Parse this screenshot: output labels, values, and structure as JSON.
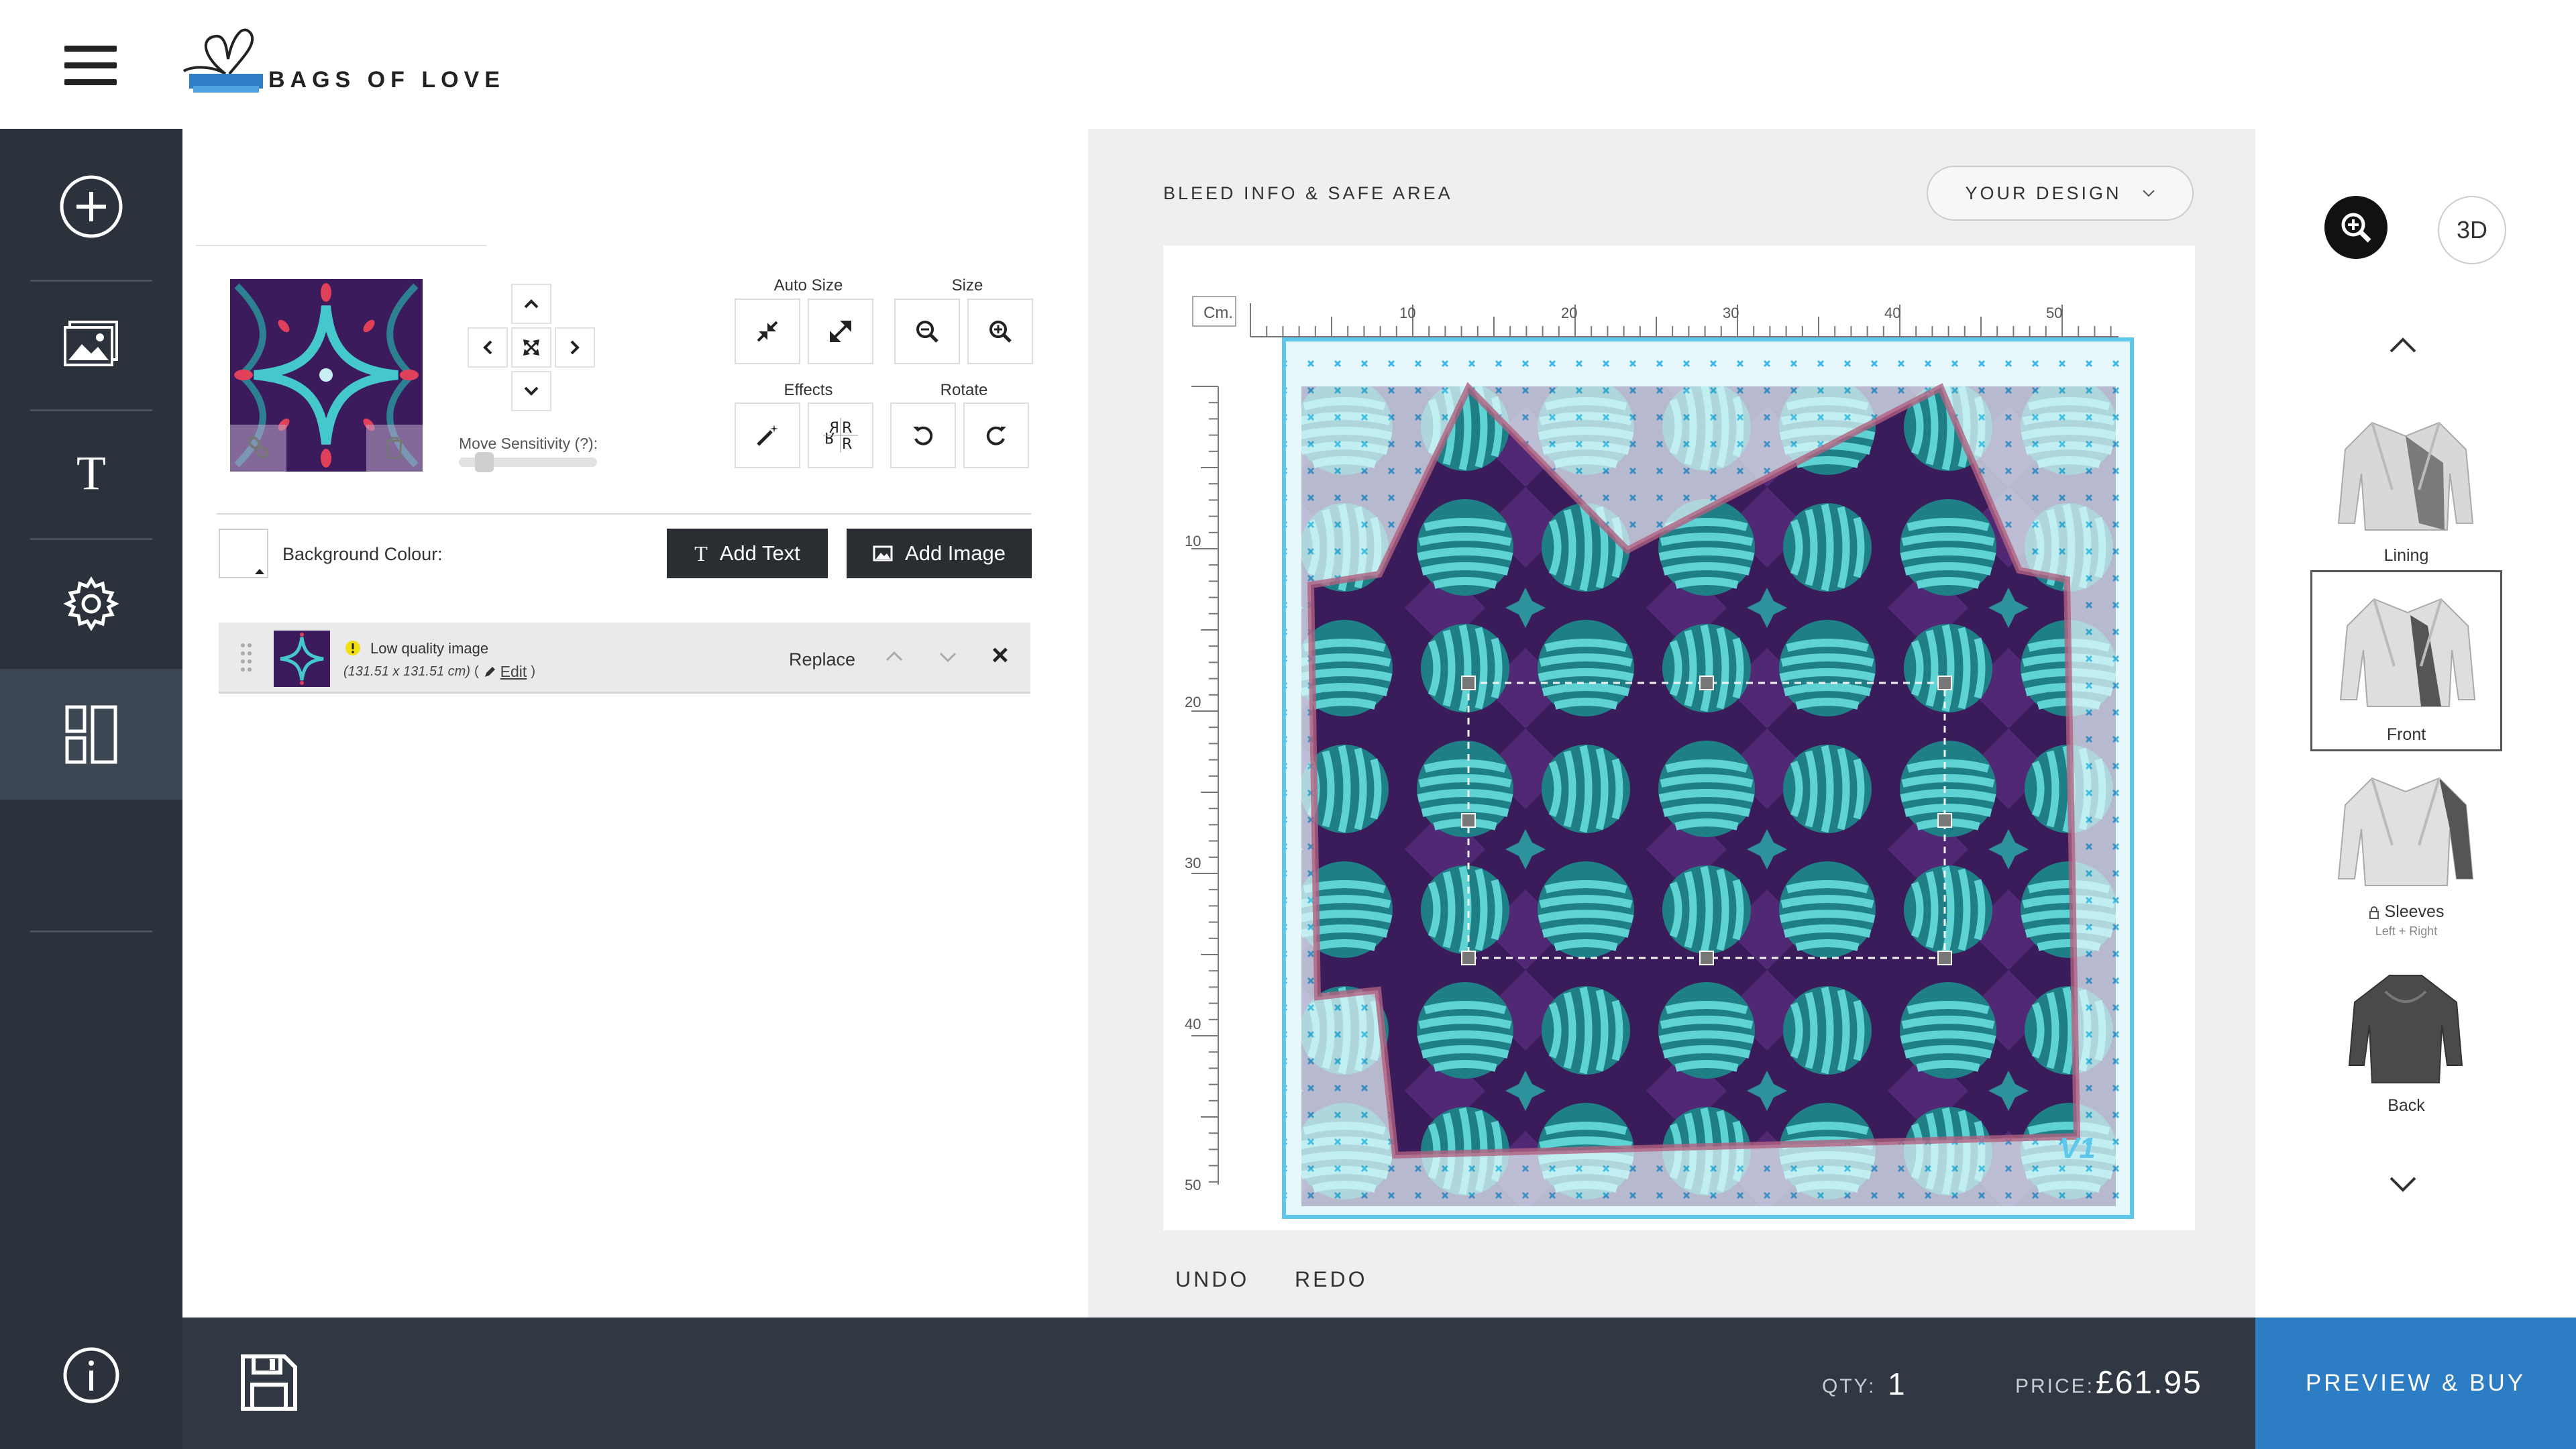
{
  "header": {
    "brand": "BAGS OF LOVE",
    "menu_icon": "hamburger-menu-icon",
    "logo_icon": "gift-bag-logo-icon"
  },
  "sidebar": {
    "items": [
      {
        "icon": "plus-circle-icon",
        "active": false
      },
      {
        "icon": "image-icon",
        "active": false
      },
      {
        "icon": "text-icon",
        "glyph": "T",
        "active": false
      },
      {
        "icon": "gear-icon",
        "active": false
      },
      {
        "icon": "layout-icon",
        "active": true
      }
    ],
    "info_icon": "info-icon"
  },
  "panel": {
    "move_sensitivity_label": "Move Sensitivity (?):",
    "auto_size_label": "Auto Size",
    "size_label": "Size",
    "effects_label": "Effects",
    "rotate_label": "Rotate",
    "background_colour_label": "Background Colour:",
    "add_text_label": "Add Text",
    "add_image_label": "Add Image",
    "layer": {
      "warning": "Low quality image",
      "dimensions": "(131.51 x 131.51 cm)",
      "open_paren": "(",
      "edit_label": "Edit",
      "close_paren": ")",
      "replace_label": "Replace",
      "remove_glyph": "×"
    }
  },
  "canvas": {
    "bleed_label": "BLEED INFO & SAFE AREA",
    "design_select": "YOUR DESIGN",
    "ruler_unit": "Cm.",
    "ruler_top_ticks": [
      "10",
      "20",
      "30",
      "40",
      "50"
    ],
    "ruler_left_ticks": [
      "10",
      "20",
      "30",
      "40",
      "50"
    ],
    "version_mark": "V1",
    "undo_label": "UNDO",
    "redo_label": "REDO"
  },
  "views": {
    "items": [
      {
        "label": "Lining",
        "sub": "",
        "active": false
      },
      {
        "label": "Front",
        "sub": "",
        "active": true
      },
      {
        "label": "Sleeves",
        "sub": "Left + Right",
        "active": false,
        "locked": true
      },
      {
        "label": "Back",
        "sub": "",
        "active": false
      }
    ],
    "three_d_label": "3D"
  },
  "footer": {
    "qty_label": "QTY:",
    "qty_value": "1",
    "price_label": "PRICE:",
    "price_value": "£61.95",
    "preview_buy_label": "PREVIEW & BUY"
  },
  "colors": {
    "sidebar_bg": "#2b323b",
    "footer_bg": "#2f3843",
    "accent_blue": "#2d7dc4",
    "pattern_purple": "#3a1c5a",
    "pattern_teal": "#3fc0c3",
    "bleed_cyan": "#5ec8ec"
  }
}
